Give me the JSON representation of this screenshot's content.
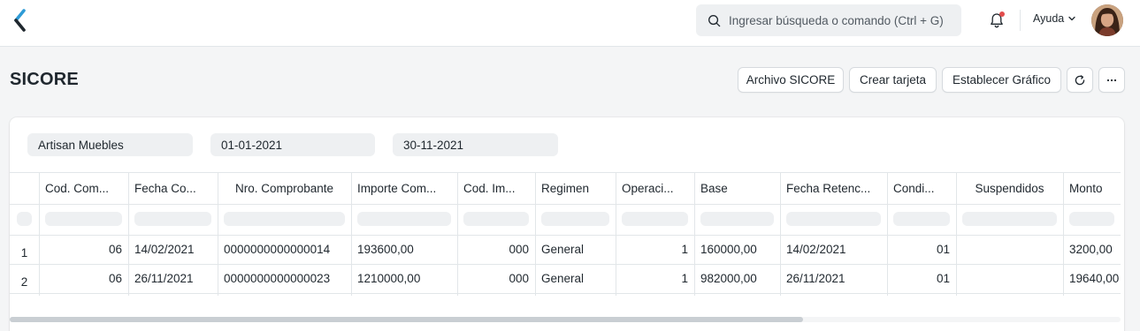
{
  "search": {
    "placeholder": "Ingresar búsqueda o comando (Ctrl + G)"
  },
  "navbar": {
    "help_label": "Ayuda"
  },
  "page": {
    "title": "SICORE"
  },
  "actions": {
    "archivo": "Archivo SICORE",
    "crear_tarjeta": "Crear tarjeta",
    "establecer_grafico": "Establecer Gráfico"
  },
  "filters": {
    "company": "Artisan Muebles",
    "from_date": "01-01-2021",
    "to_date": "30-11-2021"
  },
  "table": {
    "columns": [
      "Cod. Com...",
      "Fecha Co...",
      "Nro. Comprobante",
      "Importe Com...",
      "Cod. Im...",
      "Regimen",
      "Operaci...",
      "Base",
      "Fecha Retenc...",
      "Condi...",
      "Suspendidos",
      "Monto"
    ],
    "rows": [
      {
        "index": "1",
        "cells": [
          "06",
          "14/02/2021",
          "0000000000000014",
          "193600,00",
          "000",
          "General",
          "1",
          "160000,00",
          "14/02/2021",
          "01",
          "",
          "3200,00"
        ]
      },
      {
        "index": "2",
        "cells": [
          "06",
          "26/11/2021",
          "0000000000000023",
          "1210000,00",
          "000",
          "General",
          "1",
          "982000,00",
          "26/11/2021",
          "01",
          "",
          "19640,00"
        ]
      }
    ]
  },
  "icons": {
    "logo": "chevron-logo-icon",
    "search": "search-icon",
    "notifications": "bell-icon",
    "help_caret": "chevron-down-icon",
    "refresh": "refresh-icon",
    "more": "more-horizontal-icon"
  },
  "colors": {
    "logo_dark": "#1f272e",
    "logo_accent": "#2e9bd6",
    "notification_dot": "#e24c4c"
  }
}
